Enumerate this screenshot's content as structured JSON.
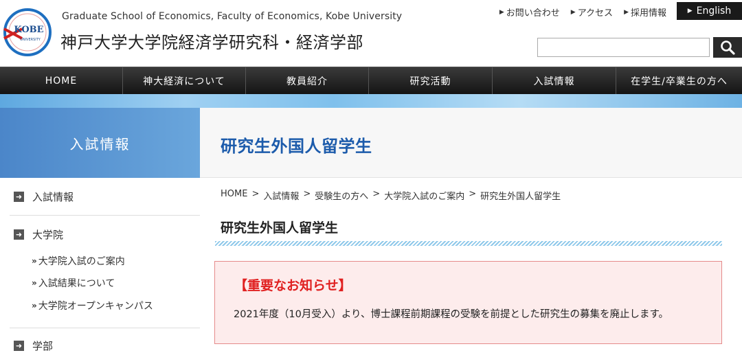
{
  "header": {
    "logo_text": "KOBE",
    "logo_sub": "UNIVERSITY",
    "subtitle_en": "Graduate School of Economics, Faculty of Economics, Kobe University",
    "title": "神戸大学大学院経済学研究科・経済学部",
    "util_links": [
      "お問い合わせ",
      "アクセス",
      "採用情報"
    ],
    "english_label": "English",
    "search_placeholder": ""
  },
  "nav": {
    "items": [
      "HOME",
      "神大経済について",
      "教員紹介",
      "研究活動",
      "入試情報",
      "在学生/卒業生の方へ"
    ]
  },
  "section": {
    "label": "入試情報",
    "page_title": "研究生外国人留学生"
  },
  "sidebar": {
    "items": [
      {
        "label": "入試情報"
      },
      {
        "label": "大学院",
        "children": [
          "大学院入試のご案内",
          "入試結果について",
          "大学院オープンキャンパス"
        ]
      },
      {
        "label": "学部"
      }
    ]
  },
  "breadcrumb": [
    "HOME",
    "入試情報",
    "受験生の方へ",
    "大学院入試のご案内",
    "研究生外国人留学生"
  ],
  "content": {
    "heading": "研究生外国人留学生",
    "notice_title": "【重要なお知らせ】",
    "notice_body": "2021年度（10月受入）より、博士課程前期課程の受験を前提とした研究生の募集を廃止します。"
  },
  "colors": {
    "accent_blue": "#1c5bab",
    "notice_red": "#e02020",
    "nav_dark": "#1a1a1a"
  }
}
